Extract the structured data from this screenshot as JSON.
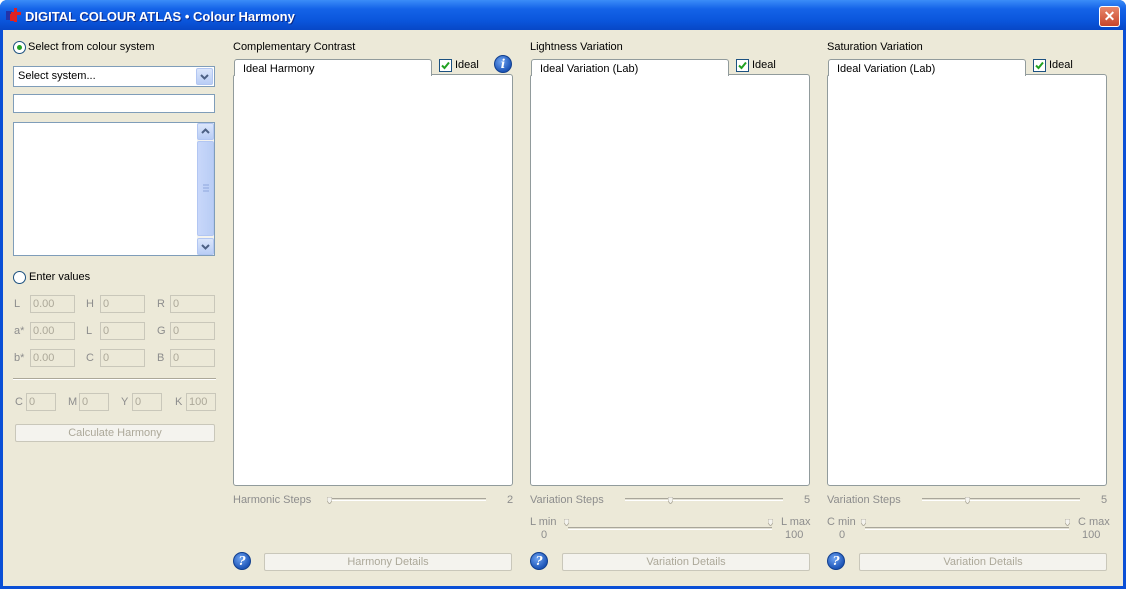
{
  "window": {
    "title": "DIGITAL COLOUR ATLAS • Colour Harmony",
    "close": "✕"
  },
  "left": {
    "select_system_label": "Select from colour system",
    "system_combo": {
      "value": "Select system..."
    },
    "search_field": {
      "value": ""
    },
    "enter_values_label": "Enter values",
    "lab": [
      {
        "label": "L",
        "value": "0.00"
      },
      {
        "label": "a*",
        "value": "0.00"
      },
      {
        "label": "b*",
        "value": "0.00"
      }
    ],
    "hlc": [
      {
        "label": "H",
        "value": "0"
      },
      {
        "label": "L",
        "value": "0"
      },
      {
        "label": "C",
        "value": "0"
      }
    ],
    "rgb": [
      {
        "label": "R",
        "value": "0"
      },
      {
        "label": "G",
        "value": "0"
      },
      {
        "label": "B",
        "value": "0"
      }
    ],
    "cmyk": [
      {
        "label": "C",
        "value": "0"
      },
      {
        "label": "M",
        "value": "0"
      },
      {
        "label": "Y",
        "value": "0"
      },
      {
        "label": "K",
        "value": "100"
      }
    ],
    "calculate_button": "Calculate Harmony"
  },
  "panels": [
    {
      "title": "Complementary Contrast",
      "tab": "Ideal Harmony",
      "ideal_label": "Ideal",
      "steps_label": "Harmonic Steps",
      "steps_value": "2",
      "details_button": "Harmony Details"
    },
    {
      "title": "Lightness Variation",
      "tab": "Ideal Variation (Lab)",
      "ideal_label": "Ideal",
      "steps_label": "Variation Steps",
      "steps_value": "5",
      "min_label": "L min",
      "min_value": "0",
      "max_label": "L max",
      "max_value": "100",
      "details_button": "Variation Details"
    },
    {
      "title": "Saturation Variation",
      "tab": "Ideal Variation (Lab)",
      "ideal_label": "Ideal",
      "steps_label": "Variation Steps",
      "steps_value": "5",
      "min_label": "C min",
      "min_value": "0",
      "max_label": "C max",
      "max_value": "100",
      "details_button": "Variation Details"
    }
  ],
  "colors": {
    "titlebar": "#0a55db",
    "face": "#ece9d8",
    "check": "#21a121"
  }
}
